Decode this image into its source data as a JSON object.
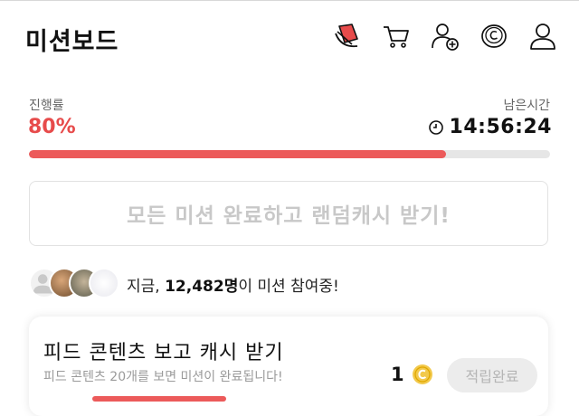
{
  "header": {
    "title": "미션보드",
    "icons": [
      "ticket-icon",
      "cart-icon",
      "add-user-icon",
      "cash-coin-icon",
      "profile-icon"
    ]
  },
  "progress": {
    "label": "진행률",
    "value_text": "80%",
    "fraction": 0.8,
    "timer_label": "남은시간",
    "timer_value": "14:56:24",
    "accent_color": "#ec5a5a"
  },
  "reward_box": {
    "text": "모든 미션 완료하고 랜덤캐시 받기!"
  },
  "participants": {
    "prefix": "지금, ",
    "count": "12,482명",
    "suffix": "이 미션 참여중!"
  },
  "mission": {
    "title": "피드 콘텐츠 보고 캐시 받기",
    "description": "피드 콘텐츠 20개를 보면 미션이 완료됩니다!",
    "reward_amount": "1",
    "claim_label": "적립완료"
  }
}
